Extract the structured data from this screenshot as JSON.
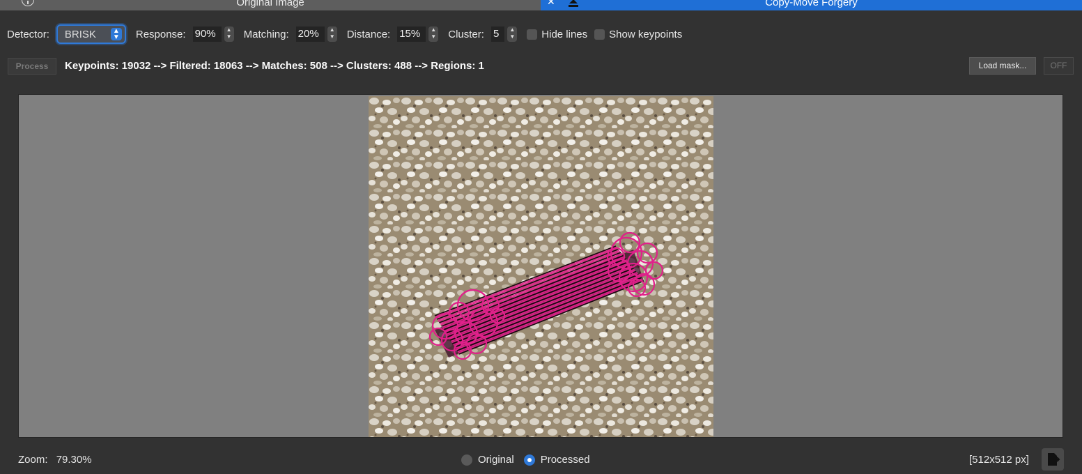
{
  "tabs": [
    {
      "label": "Original Image",
      "active": false,
      "icon": "info-icon"
    },
    {
      "label": "Copy-Move Forgery",
      "active": true,
      "icons": [
        "close-icon",
        "eject-icon"
      ]
    }
  ],
  "toolbar": {
    "detector_label": "Detector:",
    "detector_value": "BRISK",
    "response_label": "Response:",
    "response_value": "90%",
    "matching_label": "Matching:",
    "matching_value": "20%",
    "distance_label": "Distance:",
    "distance_value": "15%",
    "cluster_label": "Cluster:",
    "cluster_value": "5",
    "hide_lines_label": "Hide lines",
    "hide_lines_checked": false,
    "show_keypoints_label": "Show keypoints",
    "show_keypoints_checked": false
  },
  "actions": {
    "process_label": "Process",
    "status_text": "Keypoints: 19032 --> Filtered: 18063 --> Matches: 508 --> Clusters: 488 --> Regions: 1",
    "load_mask_label": "Load mask...",
    "off_label": "OFF"
  },
  "viewer": {
    "highlight_color": "#e0208a",
    "background_color": "#808080"
  },
  "footer": {
    "zoom_label": "Zoom:",
    "zoom_value": "79.30%",
    "radio_original": "Original",
    "radio_processed": "Processed",
    "selected_view": "Processed",
    "image_size": "[512x512 px]",
    "export_icon": "export-icon"
  },
  "colors": {
    "accent": "#2f79d8",
    "background": "#323232"
  }
}
